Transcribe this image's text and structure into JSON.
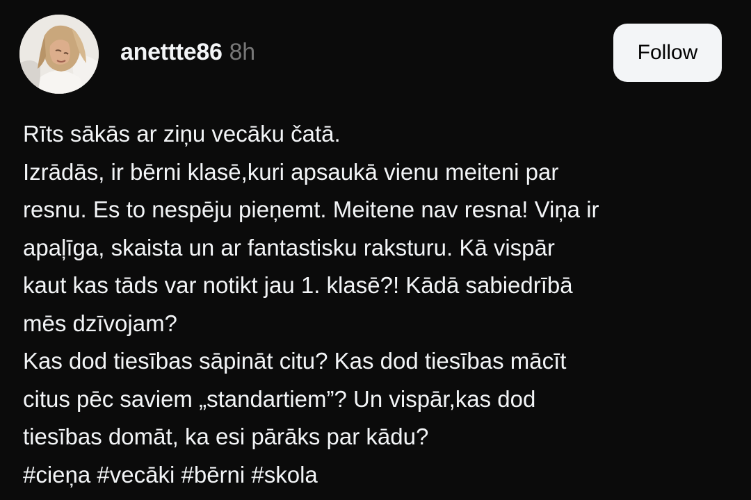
{
  "post": {
    "author": {
      "username": "anettte86",
      "time_ago": "8h",
      "avatar_icon": "profile-photo"
    },
    "follow_label": "Follow",
    "body_lines": [
      "Rīts sākās ar ziņu vecāku čatā.",
      "Izrādās, ir bērni klasē,kuri apsaukā vienu meiteni par",
      "resnu. Es to nespēju pieņemt. Meitene nav resna! Viņa ir",
      "apaļīga, skaista un ar fantastisku raksturu. Kā vispār",
      "kaut kas tāds var notikt jau 1. klasē?! Kādā sabiedrībā",
      "mēs dzīvojam?",
      "Kas dod tiesības sāpināt citu? Kas dod tiesības mācīt",
      "citus pēc saviem „standartiem”? Un vispār,kas dod",
      "tiesības domāt, ka esi pārāks par kādu?"
    ],
    "hashtags": [
      "#cieņa",
      "#vecāki",
      "#bērni",
      "#skola"
    ]
  },
  "colors": {
    "background": "#0b0b0b",
    "text": "#f3f5f7",
    "muted": "#777777",
    "button_bg": "#f3f5f7",
    "button_text": "#000000"
  }
}
